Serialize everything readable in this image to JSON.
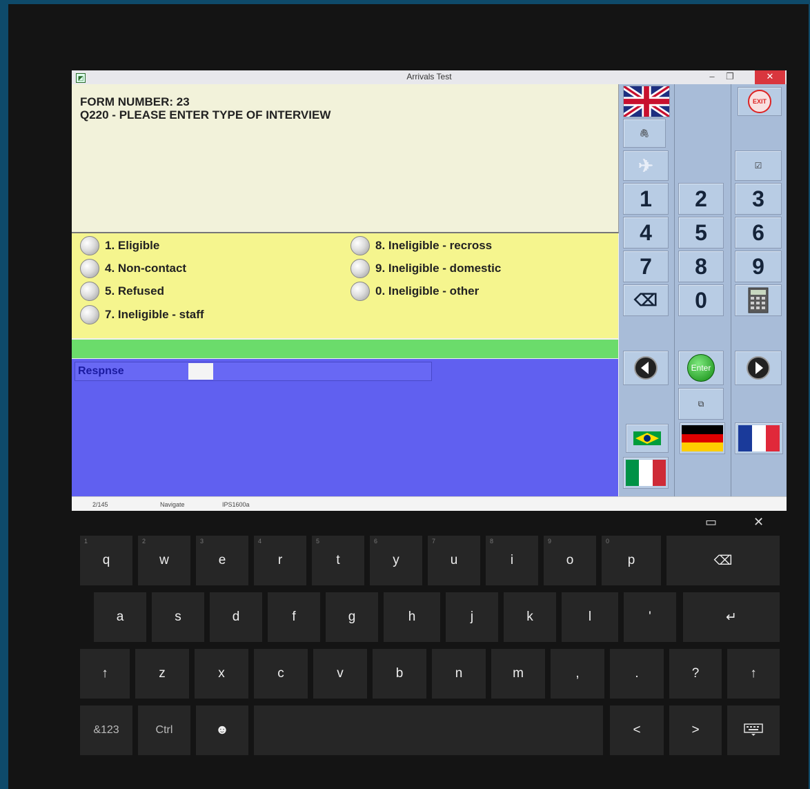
{
  "window": {
    "title": "Arrivals Test",
    "min_glyph": "–",
    "max_glyph": "❐",
    "close_glyph": "✕"
  },
  "form": {
    "form_number": "FORM NUMBER: 23",
    "question": "Q220 - PLEASE ENTER TYPE OF INTERVIEW"
  },
  "options": [
    {
      "label": "1. Eligible"
    },
    {
      "label": "4. Non-contact"
    },
    {
      "label": "5. Refused"
    },
    {
      "label": "7. Ineligible - staff"
    },
    {
      "label": "8. Ineligible - recross"
    },
    {
      "label": "9. Ineligible - domestic"
    },
    {
      "label": "0. Ineligible - other"
    }
  ],
  "response": {
    "label": "Respnse",
    "value": ""
  },
  "status": {
    "page": "2/145",
    "mode": "Navigate",
    "code": "IPS1600a"
  },
  "panel": {
    "exit_label": "EXIT",
    "enter_label": "Enter",
    "numpad": [
      "1",
      "2",
      "3",
      "4",
      "5",
      "6",
      "7",
      "8",
      "9",
      "0"
    ],
    "backspace_glyph": "⌫",
    "flags": [
      "uk-flag",
      "brazil-flag",
      "germany-flag",
      "france-flag",
      "italy-flag"
    ]
  },
  "keyboard": {
    "row1": [
      "q",
      "w",
      "e",
      "r",
      "t",
      "y",
      "u",
      "i",
      "o",
      "p"
    ],
    "row1_hints": [
      "1",
      "2",
      "3",
      "4",
      "5",
      "6",
      "7",
      "8",
      "9",
      "0"
    ],
    "row2": [
      "a",
      "s",
      "d",
      "f",
      "g",
      "h",
      "j",
      "k",
      "l",
      "'"
    ],
    "row3": [
      "z",
      "x",
      "c",
      "v",
      "b",
      "n",
      "m",
      ",",
      ".",
      "?"
    ],
    "symbols_label": "&123",
    "ctrl_label": "Ctrl",
    "smiley_glyph": "☻",
    "left_arrow": "<",
    "right_arrow": ">",
    "shift_glyph": "↑",
    "enter_glyph": "↵",
    "backspace_glyph": "⌫",
    "dock_glyph": "▭",
    "close_glyph": "✕"
  }
}
